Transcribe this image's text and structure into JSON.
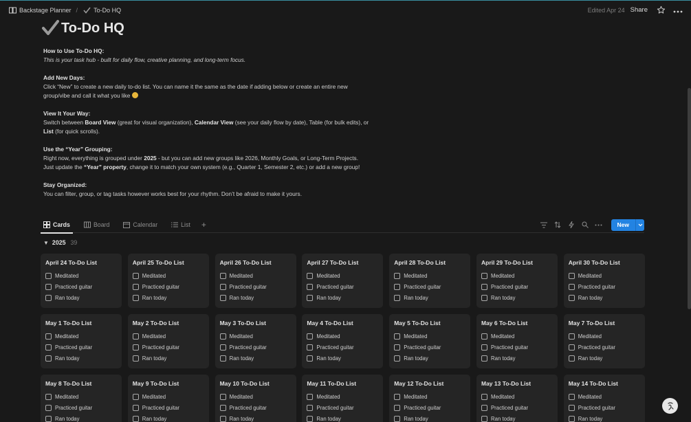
{
  "breadcrumb": {
    "parent": "Backstage Planner",
    "separator": "/",
    "current": "To-Do HQ"
  },
  "topbar": {
    "edited": "Edited Apr 24",
    "share_label": "Share"
  },
  "page": {
    "title": "To-Do HQ"
  },
  "description": {
    "how_heading": "How to Use To-Do HQ:",
    "how_text": "This is your task hub - built for daily flow, creative planning, and long-term focus.",
    "add_heading": "Add New Days:",
    "add_text_1": "Click “New” to create a new daily to-do list. You can name it the same as the date if adding below or create an entire new",
    "add_text_2": "group/vibe and call it what you like",
    "view_heading": "View It Your Way:",
    "view_1": "Switch between ",
    "view_board": "Board View",
    "view_2": " (great for visual organization), ",
    "view_calendar": "Calendar View",
    "view_3": " (see your daily flow by date), Table (for bulk edits), or",
    "view_list": "List",
    "view_4": " (for quick scrolls).",
    "year_heading": "Use the “Year” Grouping:",
    "year_1": "Right now, everything is grouped under ",
    "year_2025": "2025",
    "year_2": " - but you can add new groups like 2026, Monthly Goals, or Long-Term Projects.",
    "year_3": "Just update the ",
    "year_prop": "“Year” property",
    "year_4": ", change it to match your own system (e.g., Quarter 1, Semester 2, etc.) or add a new group!",
    "stay_heading": "Stay Organized:",
    "stay_text": "You can filter, group, or tag tasks however works best for your rhythm. Don’t be afraid to make it yours."
  },
  "views": {
    "tabs": [
      {
        "label": "Cards",
        "icon": "cards-icon"
      },
      {
        "label": "Board",
        "icon": "board-icon"
      },
      {
        "label": "Calendar",
        "icon": "calendar-icon"
      },
      {
        "label": "List",
        "icon": "list-icon"
      }
    ],
    "active": "Cards",
    "new_label": "New"
  },
  "group": {
    "name": "2025",
    "count": "39"
  },
  "checklist_items": [
    "Meditated",
    "Practiced guitar",
    "Ran today"
  ],
  "cards": [
    "April 24 To-Do List",
    "April 25 To-Do List",
    "April 26 To-Do List",
    "April 27 To-Do List",
    "April 28 To-Do List",
    "April 29 To-Do List",
    "April 30 To-Do List",
    "May 1 To-Do List",
    "May 2 To-Do List",
    "May 3 To-Do List",
    "May 4 To-Do List",
    "May 5 To-Do List",
    "May 6 To-Do List",
    "May 7 To-Do List",
    "May 8 To-Do List",
    "May 9 To-Do List",
    "May 10 To-Do List",
    "May 11 To-Do List",
    "May 12 To-Do List",
    "May 13 To-Do List",
    "May 14 To-Do List"
  ],
  "colors": {
    "background": "#191919",
    "card": "#252525",
    "accent": "#2383e2"
  }
}
